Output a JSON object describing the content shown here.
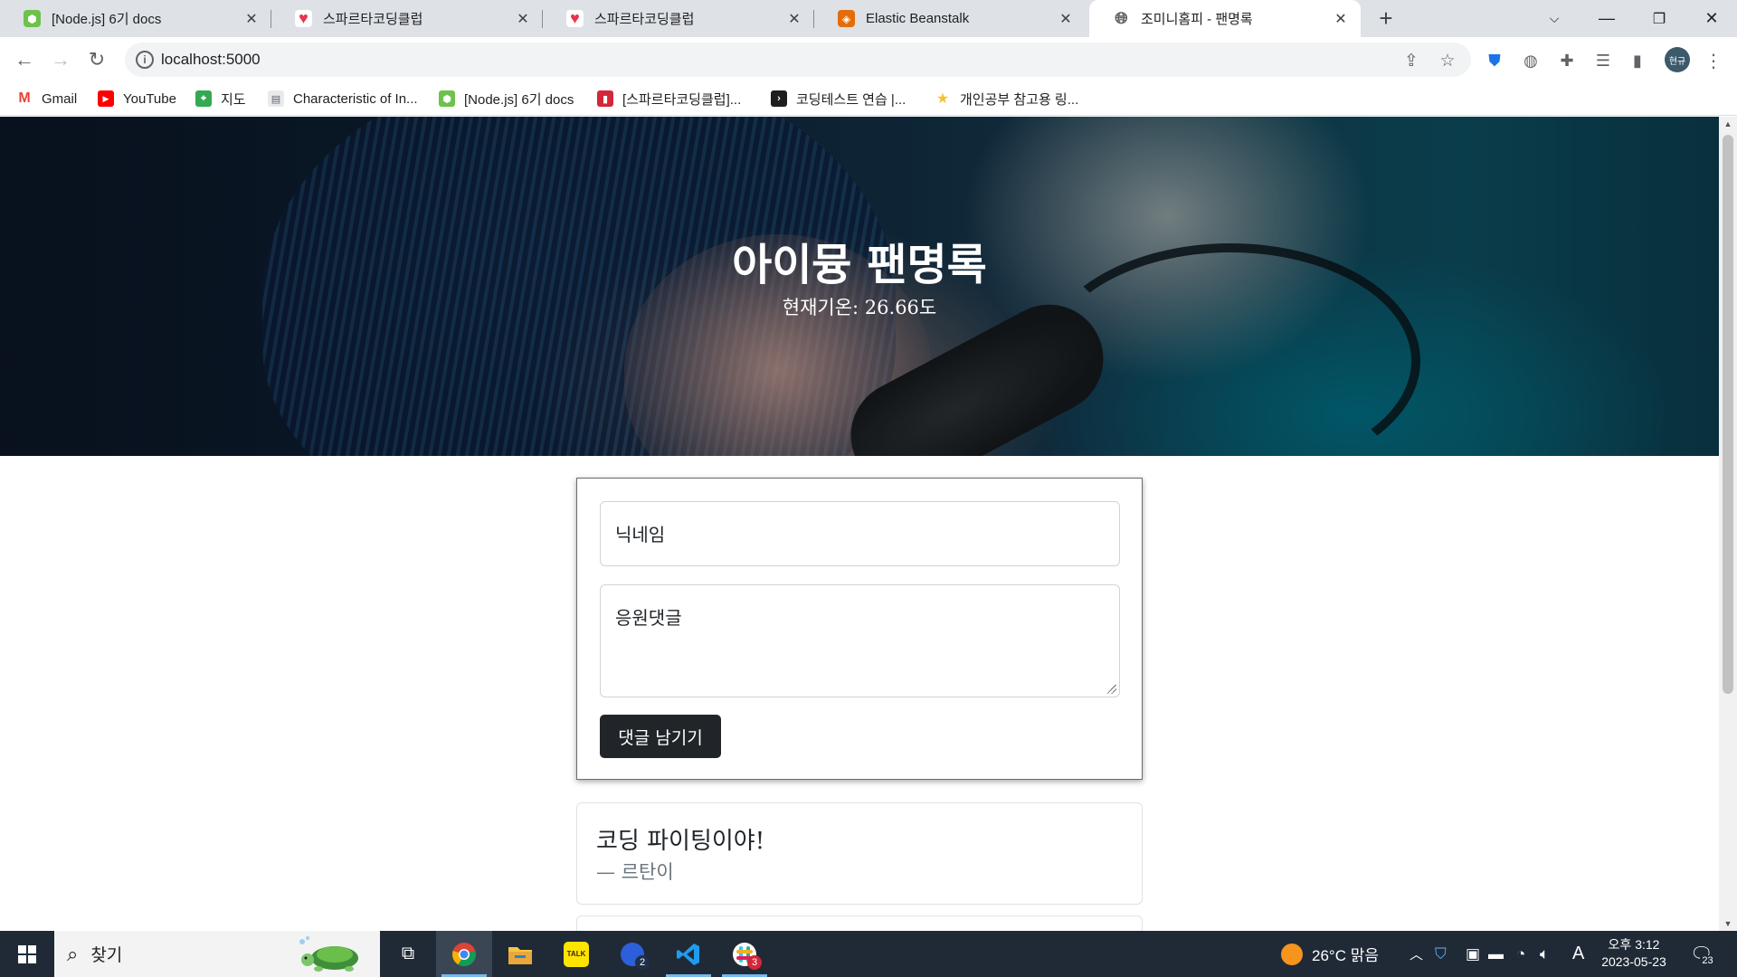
{
  "browser": {
    "tabs": [
      {
        "title": "[Node.js] 6기 docs",
        "favicon": "nodejs-hex-icon",
        "color": "#6cc24a"
      },
      {
        "title": "스파르타코딩클럽",
        "favicon": "sparta-heart-icon",
        "color": "#e8344e"
      },
      {
        "title": "스파르타코딩클럽",
        "favicon": "sparta-heart-icon",
        "color": "#e8344e"
      },
      {
        "title": "Elastic Beanstalk",
        "favicon": "aws-beanstalk-icon",
        "color": "#e46c0a"
      },
      {
        "title": "조미니홈피 - 팬명록",
        "favicon": "globe-icon",
        "color": "#5f6368"
      }
    ],
    "active_tab": 4,
    "url": "localhost:5000",
    "bookmarks": [
      {
        "label": "Gmail",
        "icon": "gmail-icon",
        "color": "#ea4335"
      },
      {
        "label": "YouTube",
        "icon": "youtube-icon",
        "color": "#ff0000"
      },
      {
        "label": "지도",
        "icon": "maps-icon",
        "color": "#34a853"
      },
      {
        "label": "Characteristic of In...",
        "icon": "document-icon",
        "color": "#9aa0a6"
      },
      {
        "label": "[Node.js] 6기 docs",
        "icon": "nodejs-hex-icon",
        "color": "#6cc24a"
      },
      {
        "label": "[스파르타코딩클럽]...",
        "icon": "book-icon",
        "color": "#d4263a"
      },
      {
        "label": "코딩테스트 연습 |...",
        "icon": "programmers-icon",
        "color": "#1e1e1e"
      },
      {
        "label": "개인공부 참고용 링...",
        "icon": "star-folder-icon",
        "color": "#f4c430"
      }
    ]
  },
  "page": {
    "title": "아이뮹 팬명록",
    "temperature": "현재기온: 26.66도",
    "form": {
      "nickname_placeholder": "닉네임",
      "comment_placeholder": "응원댓글",
      "submit_label": "댓글 남기기"
    },
    "comments": [
      {
        "message": "코딩 파이팅이야!",
        "author": "— 르탄이"
      }
    ]
  },
  "taskbar": {
    "search_placeholder": "찾기",
    "apps": [
      {
        "name": "task-view-icon",
        "badge": ""
      },
      {
        "name": "chrome-icon",
        "badge": ""
      },
      {
        "name": "file-explorer-icon",
        "badge": ""
      },
      {
        "name": "kakaotalk-icon",
        "badge": ""
      },
      {
        "name": "app-blue-icon",
        "badge": "2"
      },
      {
        "name": "vscode-icon",
        "badge": ""
      },
      {
        "name": "slack-icon",
        "badge": "3"
      }
    ],
    "weather": "26°C 맑음",
    "ime": "A",
    "time": "오후 3:12",
    "date": "2023-05-23",
    "notifications": "23"
  }
}
